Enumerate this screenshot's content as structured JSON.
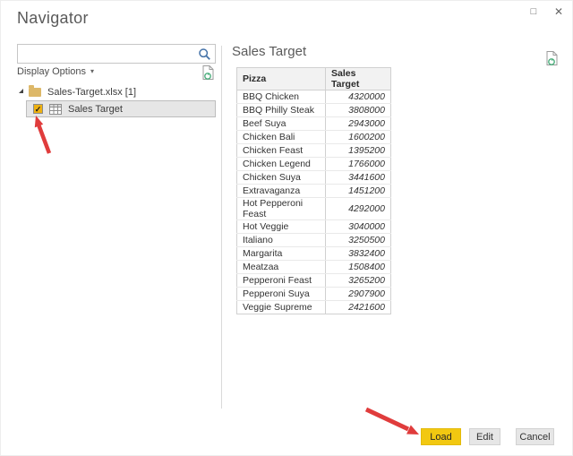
{
  "window": {
    "title": "Navigator",
    "maximize_glyph": "□",
    "close_glyph": "✕"
  },
  "left_panel": {
    "search": {
      "value": "",
      "placeholder": ""
    },
    "display_options_label": "Display Options",
    "display_options_caret": "▾",
    "tree": {
      "root_label": "Sales-Target.xlsx [1]",
      "child_label": "Sales Target",
      "child_checked": true,
      "check_glyph": "✓"
    }
  },
  "preview": {
    "title": "Sales Target",
    "table": {
      "columns": [
        "Pizza",
        "Sales Target"
      ],
      "rows": [
        [
          "BBQ Chicken",
          "4320000"
        ],
        [
          "BBQ Philly Steak",
          "3808000"
        ],
        [
          "Beef Suya",
          "2943000"
        ],
        [
          "Chicken Bali",
          "1600200"
        ],
        [
          "Chicken Feast",
          "1395200"
        ],
        [
          "Chicken Legend",
          "1766000"
        ],
        [
          "Chicken Suya",
          "3441600"
        ],
        [
          "Extravaganza",
          "1451200"
        ],
        [
          "Hot Pepperoni Feast",
          "4292000"
        ],
        [
          "Hot Veggie",
          "3040000"
        ],
        [
          "Italiano",
          "3250500"
        ],
        [
          "Margarita",
          "3832400"
        ],
        [
          "Meatzaa",
          "1508400"
        ],
        [
          "Pepperoni Feast",
          "3265200"
        ],
        [
          "Pepperoni Suya",
          "2907900"
        ],
        [
          "Veggie Supreme",
          "2421600"
        ]
      ]
    }
  },
  "footer": {
    "load_label": "Load",
    "edit_label": "Edit",
    "cancel_label": "Cancel"
  },
  "colors": {
    "accent_yellow": "#F2C811",
    "annotation_red": "#E03C3C",
    "checkbox_gold": "#EEB111",
    "folder_tan": "#DDB869",
    "search_icon_blue": "#4472A8",
    "refresh_green": "#4CAF7D"
  }
}
